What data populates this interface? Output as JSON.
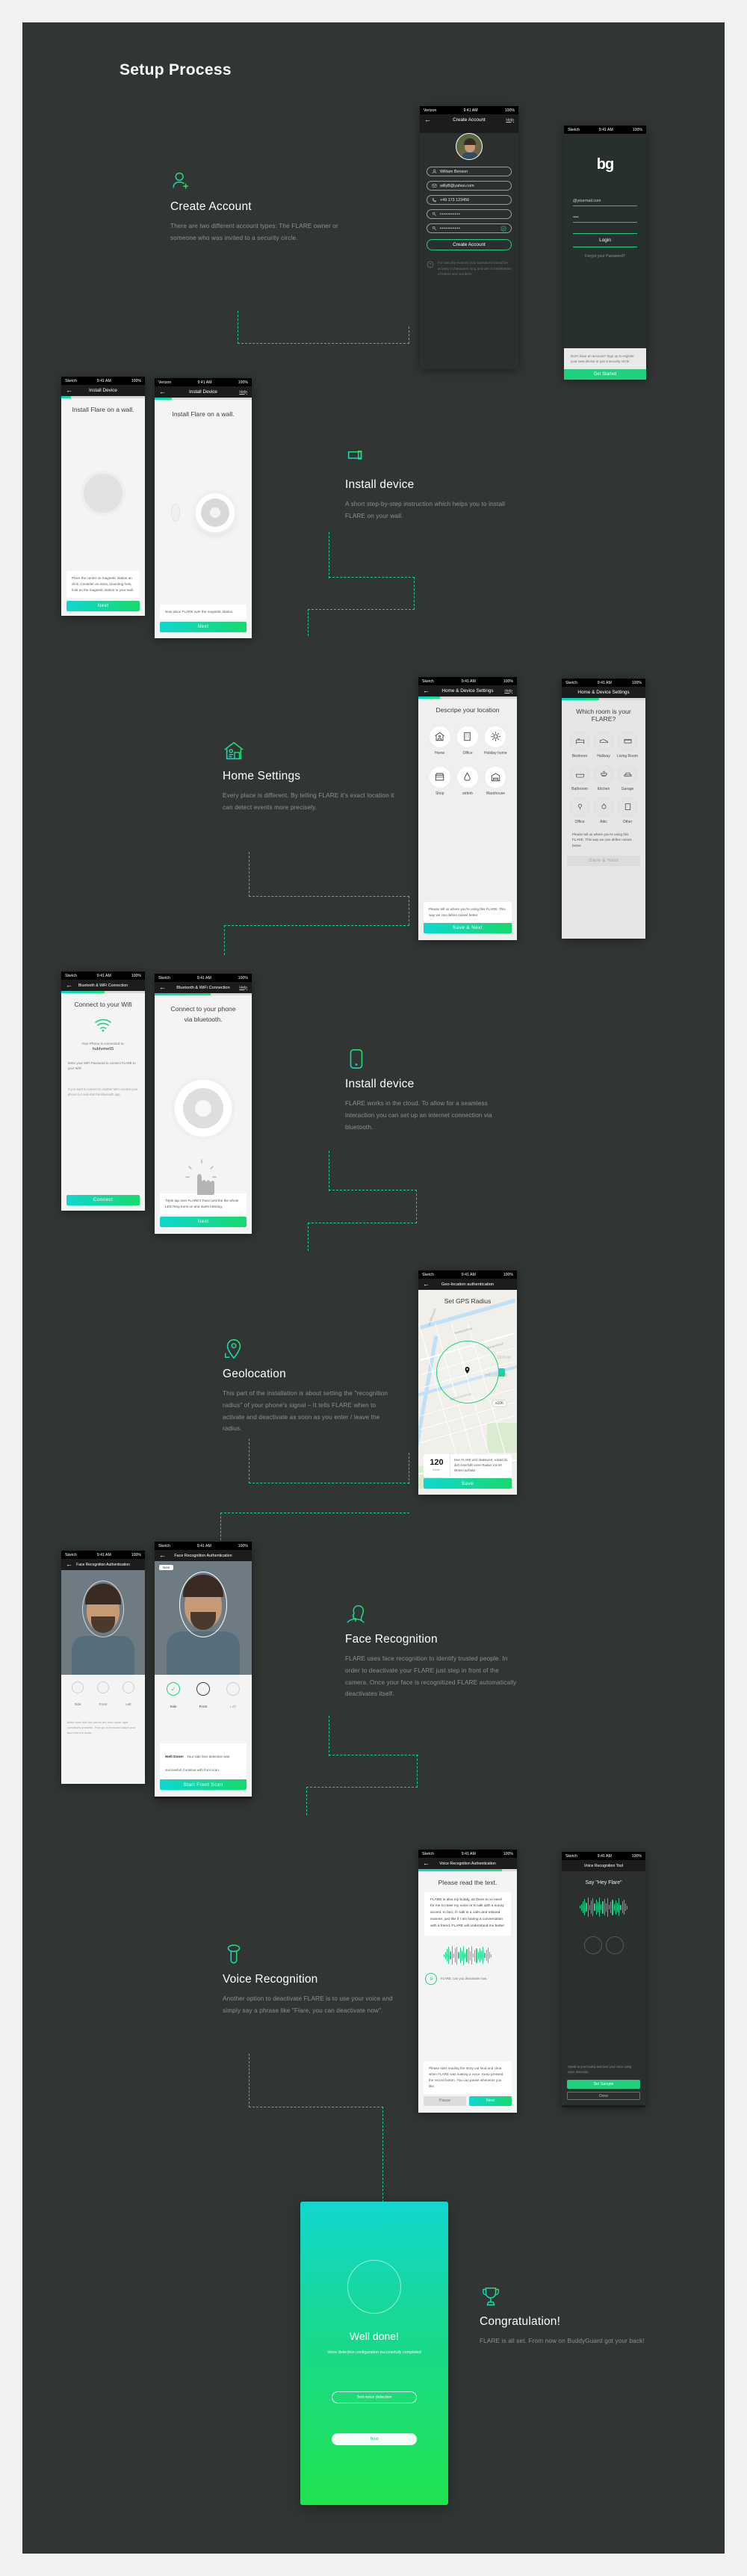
{
  "page": {
    "title": "Setup Process",
    "bg": "#313635",
    "accent": "#19c9a0",
    "accent2": "#1ee07a"
  },
  "sections": [
    {
      "id": "create-account",
      "icon": "user-add-icon",
      "title": "Create Account",
      "body": "There are two different account types: The FLARE owner or someone who was invited to a security circle."
    },
    {
      "id": "install-device-wall",
      "icon": "wall-mount-icon",
      "title": "Install device",
      "body": "A short step-by-step instruction which helps you to install FLARE on your wall."
    },
    {
      "id": "home-settings",
      "icon": "home-settings-icon",
      "title": "Home Settings",
      "body": "Every place is different. By telling FLARE it's exact location it can detect events more precisely."
    },
    {
      "id": "install-device-bluetooth",
      "icon": "phone-icon",
      "title": "Install device",
      "body": "FLARE works in the cloud. To allow for a seamless interaction you can set up an internet connection via bluetooth."
    },
    {
      "id": "geolocation",
      "icon": "map-pin-icon",
      "title": "Geolocation",
      "body": "This part of the installation is about setting the \"recognition radius\" of your phone's signal – It tells FLARE when to activate and deactivate as soon as you enter / leave the radius."
    },
    {
      "id": "face-recognition",
      "icon": "face-profile-icon",
      "title": "Face Recognition",
      "body": "FLARE uses face recognition to identify trusted people. In order to deactivate your FLARE just step in front of the camera. Once your face is recognitized FLARE automatically deactivates itself."
    },
    {
      "id": "voice-recognition",
      "icon": "microphone-icon",
      "title": "Voice Recognition",
      "body": "Another option to deactivate FLARE is to use your voice and simply say a phrase like \"Flare, you can deactivate now\"."
    },
    {
      "id": "congratulation",
      "icon": "trophy-icon",
      "title": "Congratulation!",
      "body": "FLARE is all set. From now on BuddyGuard got your back!"
    }
  ],
  "status_bar": {
    "carrier_verizon": "Verizon",
    "carrier_sketch": "Sketch",
    "time": "9:41 AM",
    "battery": "100%"
  },
  "screens": {
    "create_account": {
      "nav_title": "Create Account",
      "help": "Help",
      "fields": [
        {
          "icon": "person-icon",
          "value": "William Benson"
        },
        {
          "icon": "mail-icon",
          "value": "willyB@yahoo.com"
        },
        {
          "icon": "phone-icon",
          "value": "+49 173 123456"
        },
        {
          "icon": "key-icon",
          "value": "•••••••••••"
        },
        {
          "icon": "key-icon",
          "value": "•••••••••••",
          "check": true
        }
      ],
      "submit": "Create Account",
      "footnote": "For security reasons your password should be at least 8 characters long and use a combination of letters and numbers"
    },
    "login": {
      "logo": "bg",
      "email": "@yourmail.com",
      "password": "••••",
      "login_button": "Login",
      "forgot": "Forgot your Password?",
      "signup_prompt": "Don't have an account? Sign up to register your new device or join a security circle.",
      "get_started": "Get Started"
    },
    "install_wall_back": {
      "nav_title": "Install Device",
      "heading": "Install Flare on a wall.",
      "hint": "Place the center on magnetic station an click. Consider an extra, mounting hole, look on the magnetic station to your wall.",
      "cta": "Next"
    },
    "install_wall": {
      "nav_title": "Install Device",
      "help": "Help",
      "heading": "Install Flare on a wall.",
      "hint": "Now place FLARE over the magnetic station.",
      "cta": "Next",
      "progress": 18
    },
    "home_settings": {
      "nav_title": "Home & Device Settings",
      "help": "Help",
      "heading": "Descripe your location",
      "choices": [
        {
          "label": "Home",
          "icon": "house-icon"
        },
        {
          "label": "Office",
          "icon": "office-building-icon"
        },
        {
          "label": "Holiday home",
          "icon": "sun-icon"
        },
        {
          "label": "Shop",
          "icon": "shop-icon"
        },
        {
          "label": "airbnb",
          "icon": "airbnb-icon"
        },
        {
          "label": "Warehouse",
          "icon": "warehouse-icon"
        }
      ],
      "hint": "Please tell us where you're using this FLARE. This way we can define noises better.",
      "cta": "Save & Next",
      "progress": 22
    },
    "room_settings": {
      "nav_title": "Home & Device Settings",
      "heading": "Which room is your FLARE?",
      "choices": [
        {
          "label": "Bedroom",
          "icon": "bed-icon"
        },
        {
          "label": "Hallway",
          "icon": "shoe-icon"
        },
        {
          "label": "Living Room",
          "icon": "sofa-icon"
        },
        {
          "label": "Bathroom",
          "icon": "bath-icon"
        },
        {
          "label": "Kitchen",
          "icon": "grill-icon"
        },
        {
          "label": "Garage",
          "icon": "car-icon"
        },
        {
          "label": "Office",
          "icon": "desk-icon"
        },
        {
          "label": "Attic",
          "icon": "lamp-icon"
        },
        {
          "label": "Other",
          "icon": "door-icon"
        }
      ],
      "hint": "Please tell us where you're using this FLARE. This way we can define noises better.",
      "cta": "Save & Next",
      "progress": 45
    },
    "wifi_back": {
      "nav_title": "Bluetooth & WiFi Connection",
      "heading": "Connect to your Wifi",
      "line1": "Your Phone is connected to:",
      "network": "hubhome65",
      "line2": "Enter your WiFi Password to connect FLARE to your WiFi",
      "line3": "If you want to connect to another WiFi connect your phone to it and start the Bluetooth app.",
      "cta": "Connect"
    },
    "bluetooth": {
      "nav_title": "Bluetooth & WiFi Connection",
      "help": "Help",
      "heading_l1": "Connect to your phone",
      "heading_l2": "via bluetooth.",
      "hint": "Triple tap over FLARE's Face until the the whole LED Ring turns on and starts blinking.",
      "cta": "Next",
      "progress": 58
    },
    "geo": {
      "nav_title": "Geo-location authentication",
      "heading": "Set GPS Radius",
      "radius_value": "120",
      "radius_unit": "Meter",
      "hint": "Dein FLARE wird deaktiviert, sobald du dich innerhalb eines Radius von 50 Metern aufhälst",
      "cta": "Save",
      "map_labels": [
        "De Withstraat",
        "Bellamystraat",
        "Borgerstraat",
        "HELMERS",
        "Wilhelminastraat",
        "Overtoom",
        "OUD-W",
        "s106",
        "engracht",
        "jkstraat",
        "Kinkerstraat",
        "Hendrikkade"
      ]
    },
    "face_back": {
      "nav_title": "Face Recognition Authentication",
      "tabs": [
        "Side",
        "Front",
        "Left"
      ],
      "hint": "Make sure that the videos are shot under light conditions possible. Then go in front and place your face into the mask."
    },
    "face": {
      "nav_title": "Face Recognition Authentication",
      "badge": "New",
      "tabs": [
        {
          "label": "Side",
          "state": "done"
        },
        {
          "label": "Front",
          "state": "active"
        },
        {
          "label": "Left",
          "state": "todo"
        }
      ],
      "hint_title": "Well Done!",
      "hint": "Your side face detection was successful! Continue with front scan.",
      "cta": "Start Front Scan"
    },
    "voice": {
      "nav_title": "Voice Recognition Authentication",
      "heading": "Please read the text.",
      "passage": "FLARE is also my buddy, as there is no need for me to raise my voice or to talk with a sunny accent. In fact, if I talk in a calm and relaxed manner, just like if I am having a conversation with a friend, FLARE will understand me better.",
      "mic_label": "FLARE, can you deactivate now.",
      "hint": "Please start reading the story out loud and clear when FLARE was making a voice. Keep pressed the record button. You can pause whenever you like.",
      "btn_left": "Pause",
      "btn_right": "Next",
      "progress": 85
    },
    "voice_right": {
      "nav_title": "Voice Recognition Tool",
      "heading": "Say \"Hey Flare\"",
      "hint": "Speak to your buddy and tune your voice using voice detection.",
      "cta": "Set Sample",
      "secondary": "Done"
    },
    "done": {
      "title": "Well done!",
      "subtitle": "Voice detection configuration successfully completed",
      "test_button": "Test voice detection",
      "next_button": "Next"
    }
  }
}
